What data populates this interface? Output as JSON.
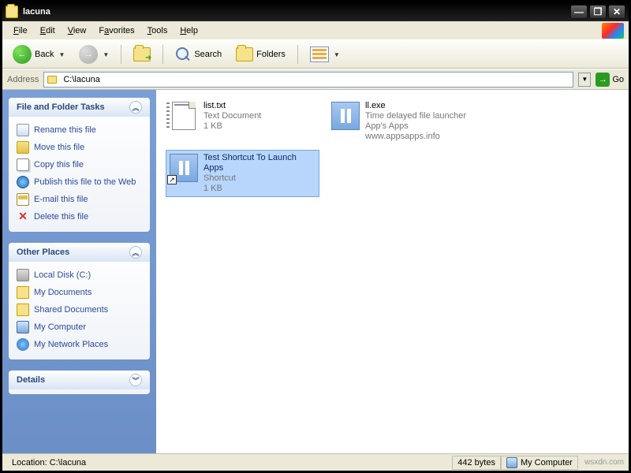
{
  "window": {
    "title": "lacuna"
  },
  "menu": {
    "file": "File",
    "edit": "Edit",
    "view": "View",
    "favorites": "Favorites",
    "tools": "Tools",
    "help": "Help"
  },
  "toolbar": {
    "back": "Back",
    "search": "Search",
    "folders": "Folders"
  },
  "address": {
    "label": "Address",
    "value": "C:\\lacuna",
    "go": "Go"
  },
  "sidebar": {
    "tasks_title": "File and Folder Tasks",
    "tasks": [
      {
        "label": "Rename this file"
      },
      {
        "label": "Move this file"
      },
      {
        "label": "Copy this file"
      },
      {
        "label": "Publish this file to the Web"
      },
      {
        "label": "E-mail this file"
      },
      {
        "label": "Delete this file"
      }
    ],
    "places_title": "Other Places",
    "places": [
      {
        "label": "Local Disk (C:)"
      },
      {
        "label": "My Documents"
      },
      {
        "label": "Shared Documents"
      },
      {
        "label": "My Computer"
      },
      {
        "label": "My Network Places"
      }
    ],
    "details_title": "Details"
  },
  "files": [
    {
      "name": "list.txt",
      "type": "Text Document",
      "size": "1 KB"
    },
    {
      "name": "ll.exe",
      "type": "Time delayed file launcher",
      "size": "App's Apps  www.appsapps.info"
    },
    {
      "name": "Test Shortcut To Launch Apps",
      "type": "Shortcut",
      "size": "1 KB"
    }
  ],
  "status": {
    "location": "Location: C:\\lacuna",
    "bytes": "442 bytes",
    "zone": "My Computer",
    "watermark": "wsxdn.com"
  }
}
